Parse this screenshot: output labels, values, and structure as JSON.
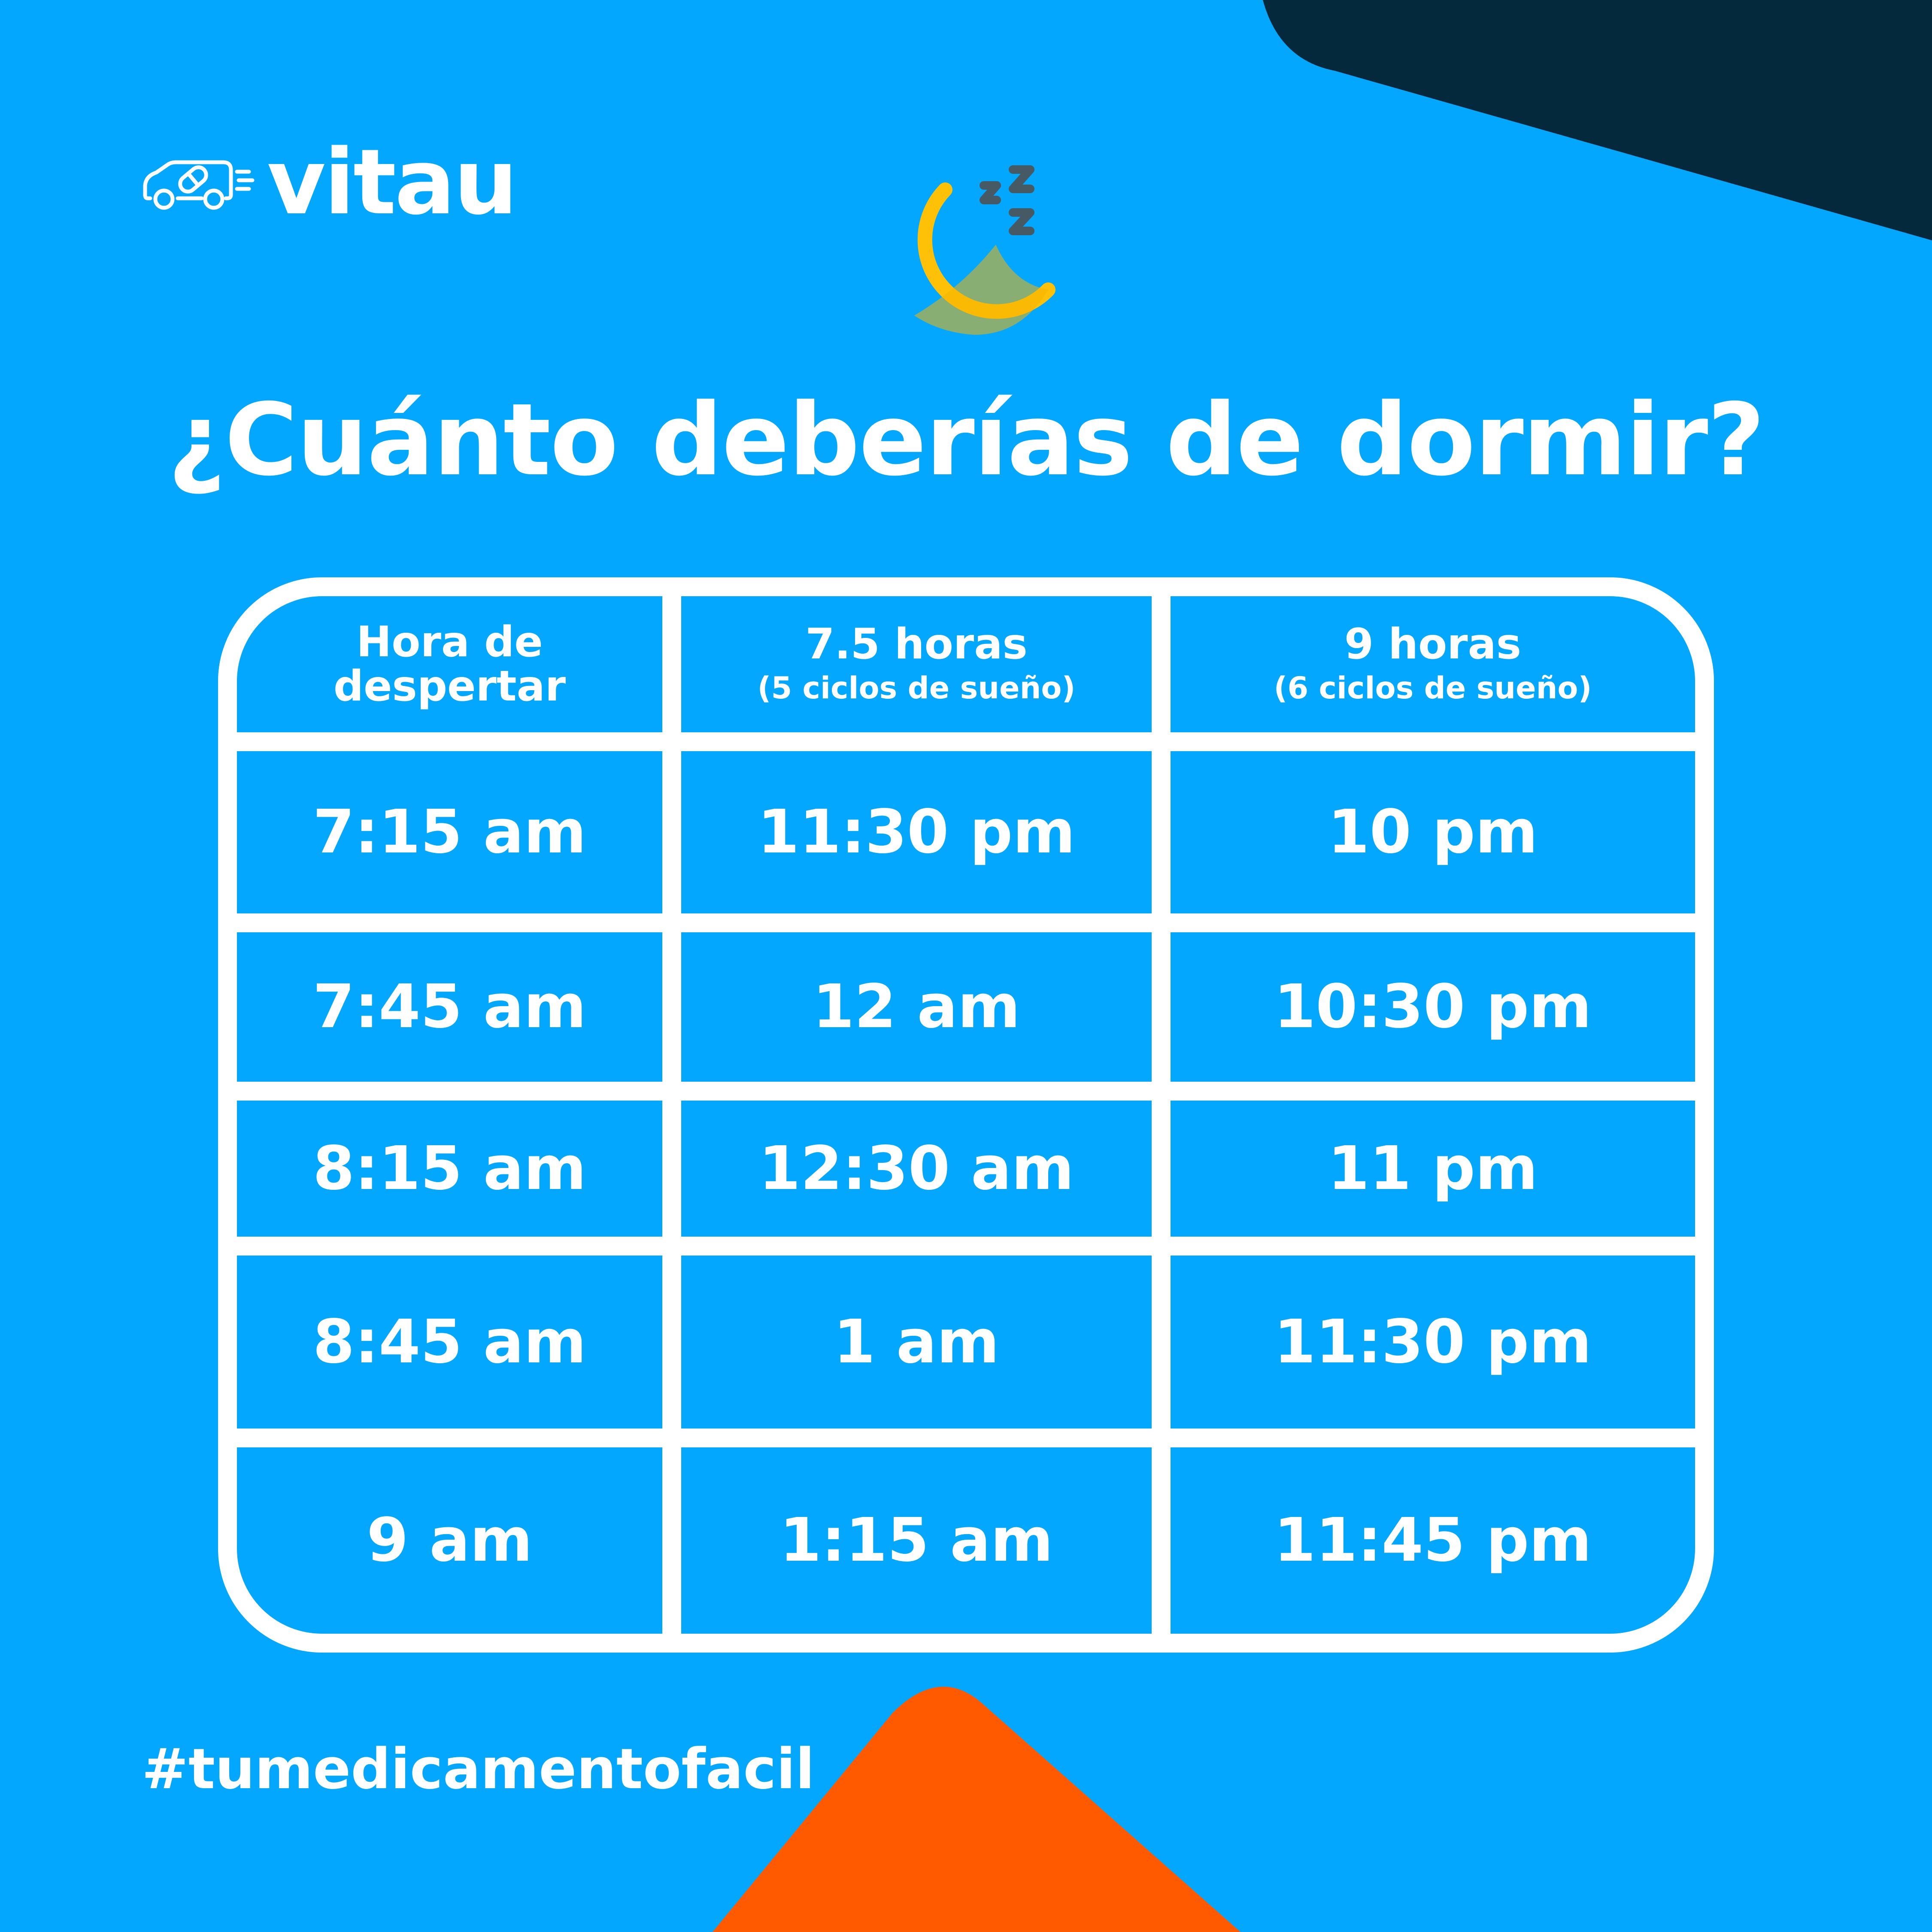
{
  "brand": {
    "name": "vitau",
    "icon": "delivery-van-pill-icon"
  },
  "decor": {
    "moon_icon": "crescent-moon-icon",
    "sleep_icon": "zzz-icon",
    "colors": {
      "background": "#03a8fe",
      "top_right_shape": "#04283c",
      "bottom_triangle": "#ff5a00",
      "moon": "#ffc107"
    }
  },
  "title": "¿Cuánto deberías de dormir?",
  "table": {
    "headers": [
      {
        "main_line1": "Hora de",
        "main_line2": "despertar",
        "sub": ""
      },
      {
        "main_line1": "7.5 horas",
        "main_line2": "",
        "sub": "(5 ciclos de sueño)"
      },
      {
        "main_line1": "9 horas",
        "main_line2": "",
        "sub": "(6 ciclos de sueño)"
      }
    ],
    "rows": [
      [
        "7:15 am",
        "11:30 pm",
        "10 pm"
      ],
      [
        "7:45 am",
        "12 am",
        "10:30 pm"
      ],
      [
        "8:15 am",
        "12:30 am",
        "11 pm"
      ],
      [
        "8:45 am",
        "1 am",
        "11:30 pm"
      ],
      [
        "9 am",
        "1:15 am",
        "11:45 pm"
      ]
    ]
  },
  "hashtag": "#tumedicamentofacil"
}
